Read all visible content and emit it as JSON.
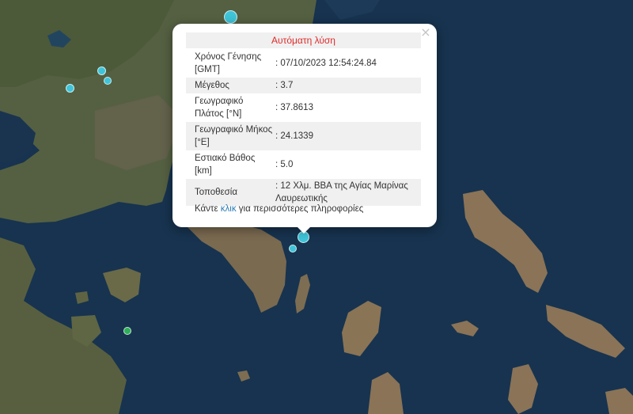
{
  "popup": {
    "title": "Αυτόματη λύση",
    "close_icon": "×",
    "rows": [
      {
        "label": "Χρόνος Γένησης [GMT]",
        "value": ": 07/10/2023 12:54:24.84"
      },
      {
        "label": "Μέγεθος",
        "value": ": 3.7"
      },
      {
        "label": "Γεωγραφικό Πλάτος [°N]",
        "value": ": 37.8613"
      },
      {
        "label": "Γεωγραφικό Μήκος [°E]",
        "value": ": 24.1339"
      },
      {
        "label": "Εστιακό Βάθος [km]",
        "value": ": 5.0"
      },
      {
        "label": "Τοποθεσία",
        "value": ": 12 Χλμ. ΒΒΑ της Αγίας Μαρίνας Λαυρεωτικής"
      }
    ],
    "more_prefix": "Κάντε ",
    "more_link": "κλικ",
    "more_suffix": " για περισσότερες πληροφορίες"
  },
  "colors": {
    "sea": "#17334f",
    "land": "#5a6043",
    "marker_cyan": "#3fc4d8",
    "marker_green": "#2fae5a",
    "title_red": "#e02a2a",
    "link_blue": "#2a7bb5"
  }
}
